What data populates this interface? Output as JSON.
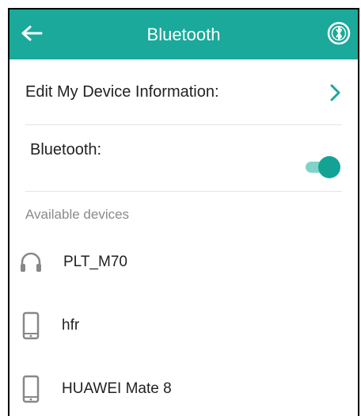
{
  "header": {
    "title": "Bluetooth",
    "back_icon": "arrow-left-icon",
    "scan_icon": "bluetooth-scan-icon"
  },
  "settings": {
    "edit_device_label": "Edit My Device Information:",
    "bluetooth_label": "Bluetooth:",
    "bluetooth_enabled": true
  },
  "devices": {
    "section_label": "Available devices",
    "items": [
      {
        "name": "PLT_M70",
        "icon": "headphones-icon"
      },
      {
        "name": "hfr",
        "icon": "phone-icon"
      },
      {
        "name": "HUAWEI Mate 8",
        "icon": "phone-icon"
      }
    ]
  },
  "colors": {
    "accent": "#1aa99a",
    "toggle_on": "#13a394"
  }
}
